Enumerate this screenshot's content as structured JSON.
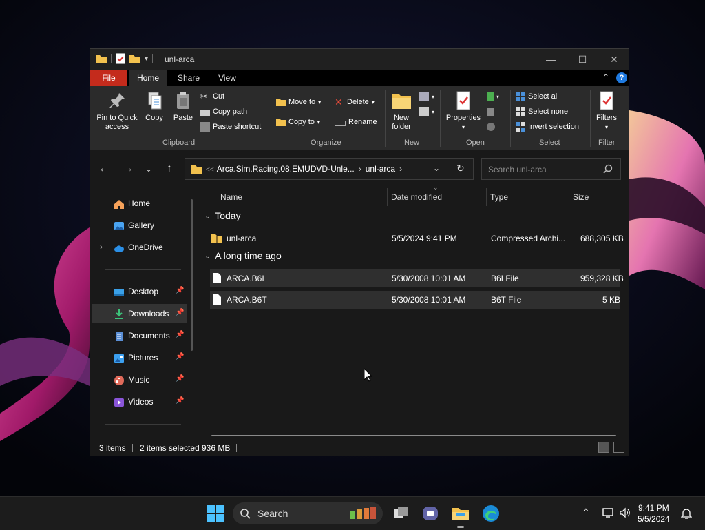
{
  "window": {
    "title": "unl-arca",
    "controls": {
      "minimize": "—",
      "maximize": "☐",
      "close": "✕"
    }
  },
  "ribbon_tabs": {
    "file": "File",
    "home": "Home",
    "share": "Share",
    "view": "View",
    "help": "?"
  },
  "ribbon": {
    "clipboard": {
      "label": "Clipboard",
      "pin_line1": "Pin to Quick",
      "pin_line2": "access",
      "copy": "Copy",
      "paste": "Paste",
      "cut": "Cut",
      "copy_path": "Copy path",
      "paste_shortcut": "Paste shortcut"
    },
    "organize": {
      "label": "Organize",
      "move_to": "Move to",
      "copy_to": "Copy to",
      "delete": "Delete",
      "rename": "Rename"
    },
    "new": {
      "label": "New",
      "new_folder_line1": "New",
      "new_folder_line2": "folder"
    },
    "open": {
      "label": "Open",
      "properties": "Properties"
    },
    "select": {
      "label": "Select",
      "select_all": "Select all",
      "select_none": "Select none",
      "invert_selection": "Invert selection"
    },
    "filter": {
      "label": "Filter",
      "filters": "Filters"
    }
  },
  "address": {
    "overflow": "<<",
    "crumb1": "Arca.Sim.Racing.08.EMUDVD-Unle...",
    "crumb2": "unl-arca",
    "search_placeholder": "Search unl-arca"
  },
  "nav": {
    "home": "Home",
    "gallery": "Gallery",
    "onedrive": "OneDrive",
    "desktop": "Desktop",
    "downloads": "Downloads",
    "documents": "Documents",
    "pictures": "Pictures",
    "music": "Music",
    "videos": "Videos"
  },
  "columns": {
    "name": "Name",
    "date_modified": "Date modified",
    "type": "Type",
    "size": "Size"
  },
  "groups": [
    {
      "title": "Today",
      "files": [
        {
          "name": "unl-arca",
          "date": "5/5/2024 9:41 PM",
          "type": "Compressed Archi...",
          "size": "688,305 KB",
          "selected": false
        }
      ]
    },
    {
      "title": "A long time ago",
      "files": [
        {
          "name": "ARCA.B6I",
          "date": "5/30/2008 10:01 AM",
          "type": "B6I File",
          "size": "959,328 KB",
          "selected": true
        },
        {
          "name": "ARCA.B6T",
          "date": "5/30/2008 10:01 AM",
          "type": "B6T File",
          "size": "5 KB",
          "selected": true
        }
      ]
    }
  ],
  "status": {
    "items": "3 items",
    "selected": "2 items selected",
    "size": "936 MB"
  },
  "taskbar": {
    "search": "Search",
    "time": "9:41 PM",
    "date": "5/5/2024"
  },
  "colors": {
    "file_tab": "#c42b1c",
    "accent": "#1f7ae0",
    "folder": "#f2c14e"
  }
}
